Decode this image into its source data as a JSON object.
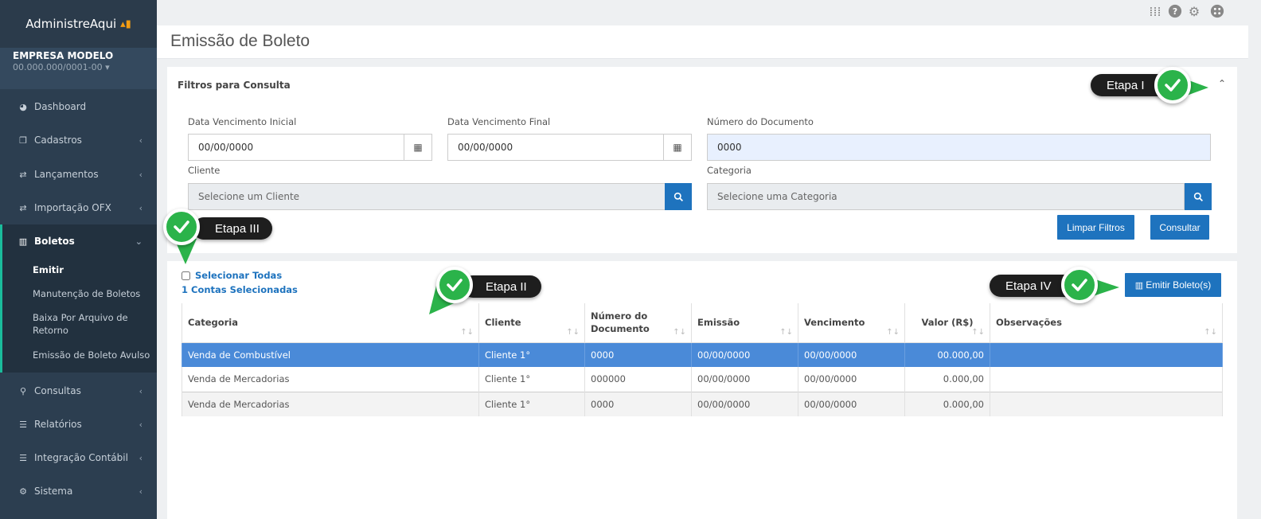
{
  "brand": {
    "name": "AdministreAqui"
  },
  "company": {
    "name": "EMPRESA MODELO",
    "cnpj": "00.000.000/0001-00 ▾"
  },
  "sidebar": {
    "items": [
      {
        "label": "Dashboard",
        "icon": "dashboard-icon"
      },
      {
        "label": "Cadastros",
        "icon": "copy-icon"
      },
      {
        "label": "Lançamentos",
        "icon": "exchange-icon"
      },
      {
        "label": "Importação OFX",
        "icon": "exchange-icon"
      },
      {
        "label": "Boletos",
        "icon": "barcode-icon"
      },
      {
        "label": "Consultas",
        "icon": "search-icon"
      },
      {
        "label": "Relatórios",
        "icon": "list-icon"
      },
      {
        "label": "Integração Contábil",
        "icon": "list-icon"
      },
      {
        "label": "Sistema",
        "icon": "cogs-icon"
      }
    ],
    "submenu": [
      {
        "label": "Emitir"
      },
      {
        "label": "Manutenção de Boletos"
      },
      {
        "label": "Baixa Por Arquivo de Retorno"
      },
      {
        "label": "Emissão de Boleto Avulso"
      }
    ]
  },
  "page": {
    "title": "Emissão de Boleto"
  },
  "filters": {
    "title": "Filtros para Consulta",
    "data_inicial_label": "Data Vencimento Inicial",
    "data_inicial_value": "00/00/0000",
    "data_final_label": "Data Vencimento Final",
    "data_final_value": "00/00/0000",
    "numero_label": "Número do Documento",
    "numero_value": "0000",
    "cliente_label": "Cliente",
    "cliente_placeholder": "Selecione um Cliente",
    "categoria_label": "Categoria",
    "categoria_placeholder": "Selecione uma Categoria",
    "limpar_label": "Limpar Filtros",
    "consultar_label": "Consultar"
  },
  "results": {
    "select_all_label": "Selecionar Todas",
    "selected_count": "1 Contas Selecionadas",
    "emitir_label": "Emitir Boleto(s)",
    "columns": [
      "Categoria",
      "Cliente",
      "Número do Documento",
      "Emissão",
      "Vencimento",
      "Valor (R$)",
      "Observações"
    ],
    "rows": [
      [
        "Venda de Combustível",
        "Cliente 1°",
        "0000",
        "00/00/0000",
        "00/00/0000",
        "00.000,00",
        ""
      ],
      [
        "Venda de Mercadorias",
        "Cliente 1°",
        "000000",
        "00/00/0000",
        "00/00/0000",
        "0.000,00",
        ""
      ],
      [
        "Venda de Mercadorias",
        "Cliente 1°",
        "0000",
        "00/00/0000",
        "00/00/0000",
        "0.000,00",
        ""
      ]
    ]
  },
  "callouts": {
    "etapa1": "Etapa I",
    "etapa2": "Etapa II",
    "etapa3": "Etapa III",
    "etapa4": "Etapa IV"
  },
  "colors": {
    "primary": "#1e73be",
    "sidebar": "#2c3e50",
    "selected_row": "#4a8ad8",
    "check": "#2bb34a",
    "accent": "#1abc9c"
  }
}
